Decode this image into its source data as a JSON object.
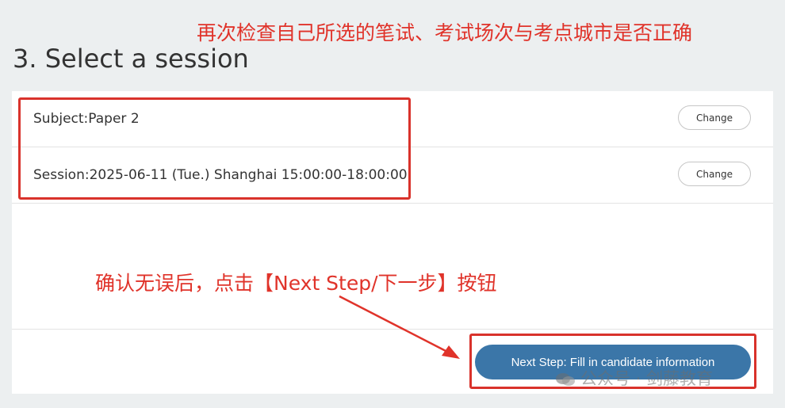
{
  "annotations": {
    "top_note": "再次检查自己所选的笔试、考试场次与考点城市是否正确",
    "middle_note": "确认无误后，点击【Next Step/下一步】按钮"
  },
  "page": {
    "heading": "3. Select a session"
  },
  "selection": {
    "subject_label": "Subject:Paper 2",
    "session_label": "Session:2025-06-11 (Tue.) Shanghai 15:00:00-18:00:00",
    "change_subject_label": "Change",
    "change_session_label": "Change"
  },
  "footer": {
    "next_button_label": "Next Step: Fill in candidate information"
  },
  "watermark": {
    "text": "公众号 · 剑藤教育",
    "icon": "wechat-icon"
  },
  "colors": {
    "annotation_red": "#e0332a",
    "button_blue": "#3b76a8",
    "background": "#eceff0"
  }
}
